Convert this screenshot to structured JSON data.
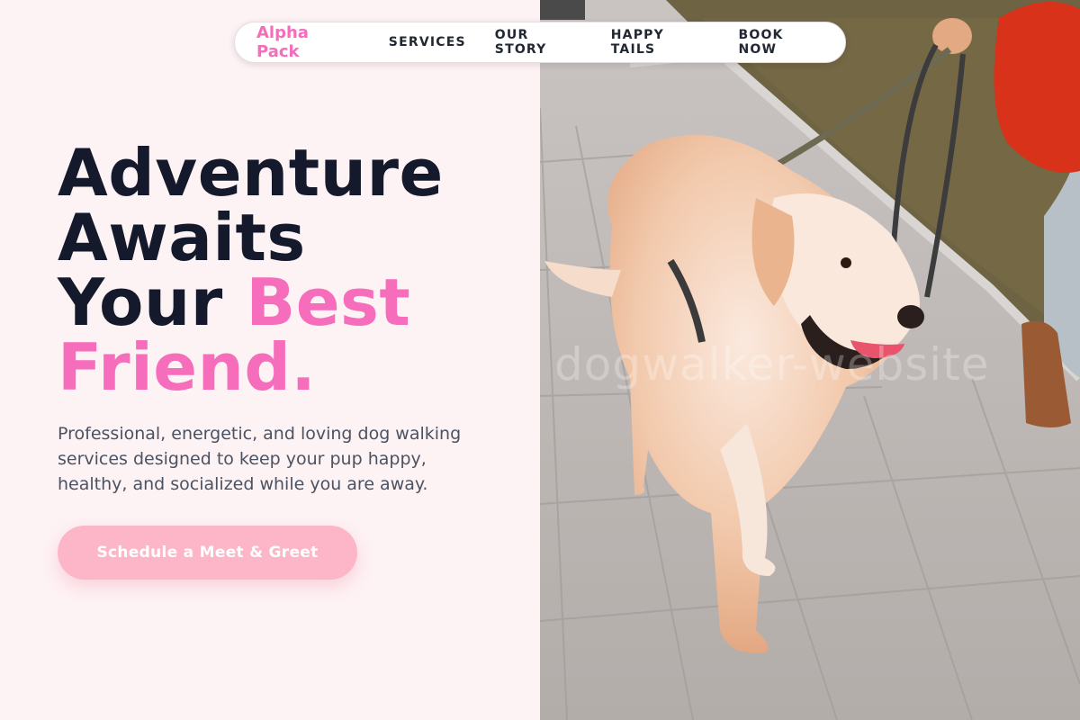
{
  "nav": {
    "brand": "Alpha Pack",
    "items": [
      {
        "label": "SERVICES"
      },
      {
        "label": "OUR STORY"
      },
      {
        "label": "HAPPY TAILS"
      },
      {
        "label": "BOOK NOW"
      }
    ]
  },
  "hero": {
    "title_line1": "Adventure",
    "title_line2": "Awaits",
    "title_line3_plain": "Your ",
    "title_line3_accent": "Best",
    "title_line4_accent": "Friend.",
    "description": "Professional, energetic, and loving dog walking services designed to keep your pup happy, healthy, and socialized while you are away.",
    "cta_label": "Schedule a Meet & Greet"
  },
  "photo": {
    "watermark": "dogwalker-website"
  },
  "colors": {
    "accent": "#f56dbb",
    "cta": "#fdb6c8",
    "background": "#fdf2f4",
    "heading": "#141a2b"
  }
}
